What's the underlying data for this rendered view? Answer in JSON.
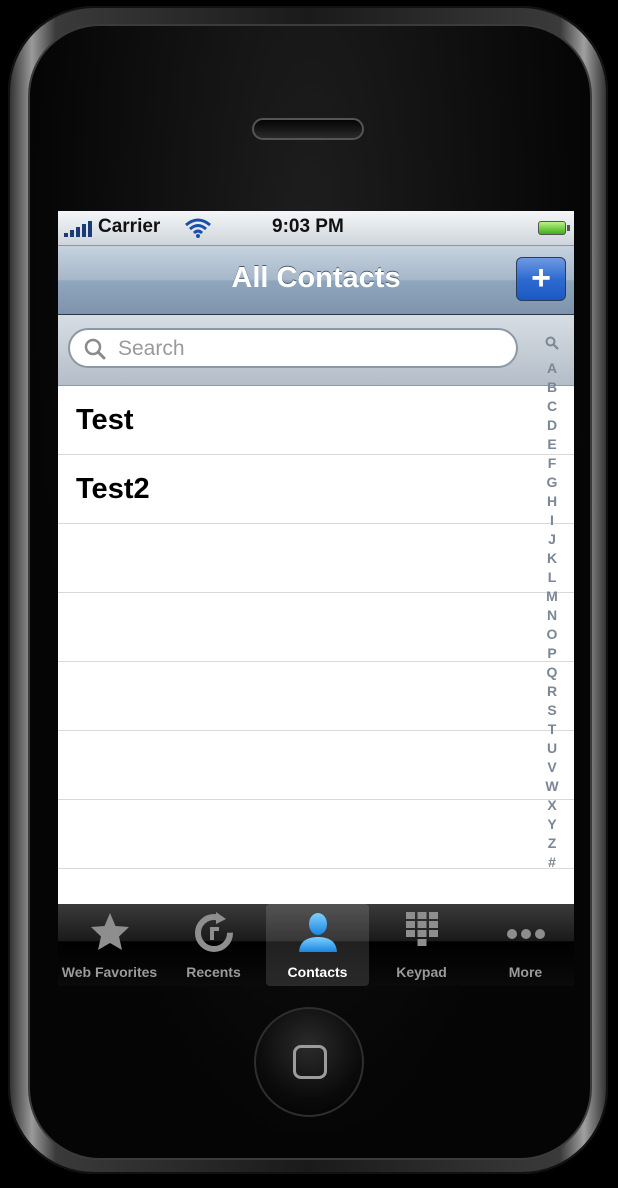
{
  "status": {
    "carrier": "Carrier",
    "time": "9:03 PM"
  },
  "nav": {
    "title": "All Contacts",
    "add_label": "+"
  },
  "search": {
    "placeholder": "Search"
  },
  "contacts": [
    "Test",
    "Test2"
  ],
  "index": [
    "A",
    "B",
    "C",
    "D",
    "E",
    "F",
    "G",
    "H",
    "I",
    "J",
    "K",
    "L",
    "M",
    "N",
    "O",
    "P",
    "Q",
    "R",
    "S",
    "T",
    "U",
    "V",
    "W",
    "X",
    "Y",
    "Z",
    "#"
  ],
  "tabs": [
    {
      "label": "Web Favorites",
      "icon": "star-icon"
    },
    {
      "label": "Recents",
      "icon": "recents-icon"
    },
    {
      "label": "Contacts",
      "icon": "person-icon"
    },
    {
      "label": "Keypad",
      "icon": "keypad-icon"
    },
    {
      "label": "More",
      "icon": "ellipsis-icon"
    }
  ],
  "selected_tab": "Contacts",
  "colors": {
    "accent": "#2e6bd1",
    "nav": "#90a6bd",
    "index": "#7b8794"
  }
}
